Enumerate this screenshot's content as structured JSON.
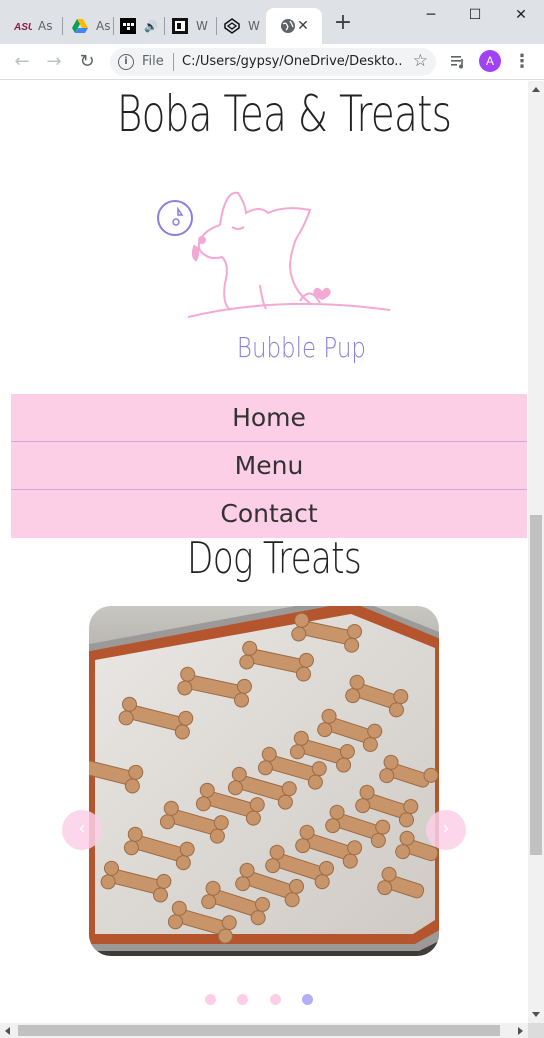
{
  "browser": {
    "tabs": [
      {
        "title": "As",
        "icon": "asu-icon"
      },
      {
        "title": "As",
        "icon": "google-drive-icon"
      },
      {
        "title": "",
        "icon": "tidal-icon"
      },
      {
        "title": "W",
        "icon": "app-icon"
      },
      {
        "title": "W",
        "icon": "codepen-icon"
      },
      {
        "title": "",
        "icon": "globe-icon",
        "active": true
      }
    ],
    "new_tab_label": "+",
    "window_controls": {
      "minimize": "─",
      "maximize": "☐",
      "close": "✕"
    },
    "omnibox": {
      "scheme": "File",
      "url": "C:/Users/gypsy/OneDrive/Deskto..."
    },
    "avatar_letter": "A"
  },
  "page": {
    "site_title": "Boba Tea & Treats",
    "logo_text": "Bubble Pup",
    "nav": [
      {
        "label": "Home"
      },
      {
        "label": "Menu"
      },
      {
        "label": "Contact"
      }
    ],
    "section_title": "Dog Treats",
    "carousel": {
      "prev_label": "‹",
      "next_label": "›",
      "slide_count": 4,
      "active_index": 3,
      "image": "dog-bone-treats-on-baking-tray"
    }
  },
  "colors": {
    "nav_bg": "#fccfe6",
    "dot_active": "#b3aef5",
    "logo_pink": "#f4a8d4",
    "logo_purple": "#8a7fe0"
  }
}
